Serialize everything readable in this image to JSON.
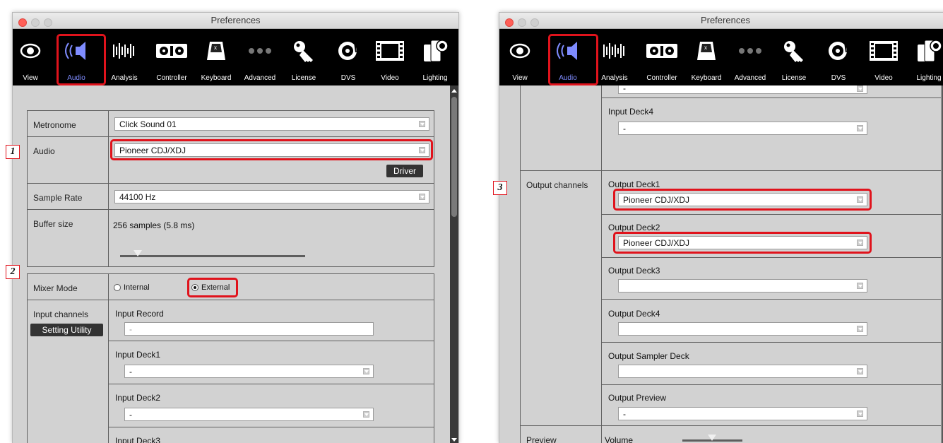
{
  "window_title": "Preferences",
  "toolbar": {
    "items": [
      {
        "label": "View",
        "icon": "eye-icon"
      },
      {
        "label": "Audio",
        "icon": "speaker-icon"
      },
      {
        "label": "Analysis",
        "icon": "waveform-icon"
      },
      {
        "label": "Controller",
        "icon": "controller-icon"
      },
      {
        "label": "Keyboard",
        "icon": "keyboard-icon"
      },
      {
        "label": "Advanced",
        "icon": "dots-icon"
      },
      {
        "label": "License",
        "icon": "key-icon"
      },
      {
        "label": "DVS",
        "icon": "turntable-icon"
      },
      {
        "label": "Video",
        "icon": "film-icon"
      },
      {
        "label": "Lighting",
        "icon": "lighting-icon"
      }
    ],
    "active": "Audio"
  },
  "left": {
    "metronome": {
      "label": "Metronome",
      "value": "Click Sound 01"
    },
    "audio": {
      "label": "Audio",
      "value": "Pioneer CDJ/XDJ",
      "driver_button": "Driver"
    },
    "sample_rate": {
      "label": "Sample Rate",
      "value": "44100 Hz"
    },
    "buffer_size": {
      "label": "Buffer size",
      "value": "256 samples (5.8 ms)",
      "slider_fraction": 0.1
    },
    "mixer_mode": {
      "label": "Mixer Mode",
      "options": [
        "Internal",
        "External"
      ],
      "selected": "External"
    },
    "input_channels": {
      "label": "Input channels",
      "setting_utility_button": "Setting Utility",
      "input_record": {
        "label": "Input Record",
        "value": "-"
      },
      "input_deck1": {
        "label": "Input Deck1",
        "value": "-"
      },
      "input_deck2": {
        "label": "Input Deck2",
        "value": "-"
      },
      "input_deck3": {
        "label": "Input Deck3",
        "value": ""
      }
    }
  },
  "right": {
    "top_partial_value": "-",
    "input_deck4": {
      "label": "Input Deck4",
      "value": "-"
    },
    "output_channels": {
      "label": "Output channels",
      "output_deck1": {
        "label": "Output Deck1",
        "value": "Pioneer CDJ/XDJ"
      },
      "output_deck2": {
        "label": "Output Deck2",
        "value": "Pioneer CDJ/XDJ"
      },
      "output_deck3": {
        "label": "Output Deck3",
        "value": ""
      },
      "output_deck4": {
        "label": "Output Deck4",
        "value": ""
      },
      "output_sampler_deck": {
        "label": "Output Sampler Deck",
        "value": ""
      },
      "output_preview": {
        "label": "Output Preview",
        "value": "-"
      }
    },
    "preview": {
      "label": "Preview",
      "volume_label": "Volume",
      "volume_fraction": 0.5
    }
  },
  "steps": [
    "1",
    "2",
    "3"
  ],
  "colors": {
    "highlight": "#e0131c",
    "active_label": "#7f8cff",
    "toolbar_bg": "#000000",
    "panel_bg": "#d2d2d2"
  }
}
